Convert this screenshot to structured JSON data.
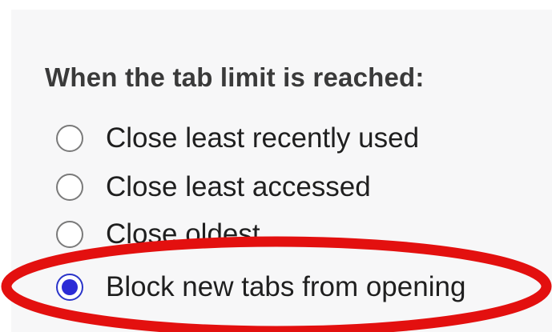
{
  "settings": {
    "heading": "When the tab limit is reached:",
    "options": [
      {
        "label": "Close least recently used",
        "checked": false
      },
      {
        "label": "Close least accessed",
        "checked": false
      },
      {
        "label": "Close oldest",
        "checked": false
      },
      {
        "label": "Block new tabs from opening",
        "checked": true
      }
    ]
  },
  "colors": {
    "accent": "#2b2bd6",
    "annotation": "#e3100f",
    "panel_bg": "#f7f7f8"
  }
}
